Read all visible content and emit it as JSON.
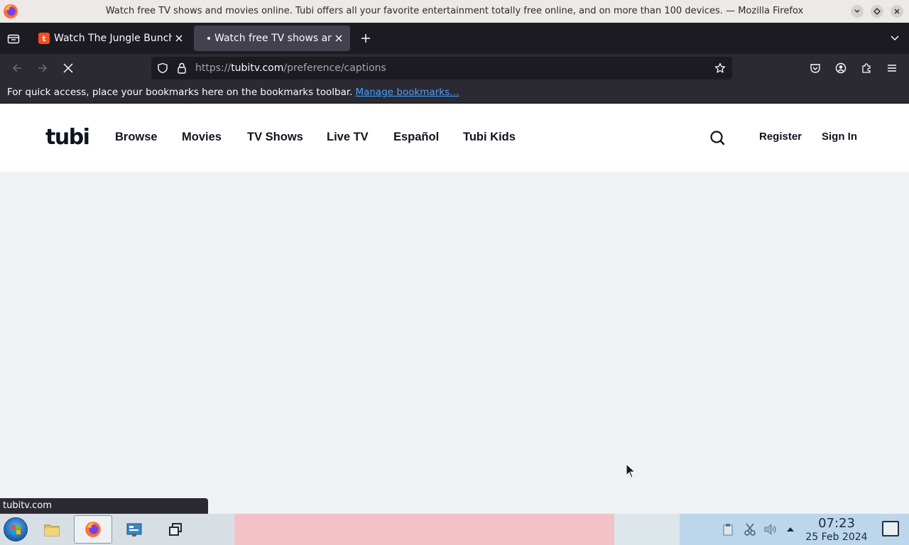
{
  "window": {
    "title": "Watch free TV shows and movies online. Tubi offers all your favorite entertainment totally free online, and on more than 100 devices. — Mozilla Firefox"
  },
  "tabs": [
    {
      "title": "Watch The Jungle Bunch",
      "active": false
    },
    {
      "title": "Watch free TV shows and",
      "active": true
    }
  ],
  "urlbar": {
    "scheme": "https://",
    "host": "tubitv.com",
    "path": "/preference/captions"
  },
  "bookmarks_bar": {
    "message": "For quick access, place your bookmarks here on the bookmarks toolbar.",
    "link": "Manage bookmarks…"
  },
  "site": {
    "logo": "tubi",
    "nav": [
      "Browse",
      "Movies",
      "TV Shows",
      "Live TV",
      "Español",
      "Tubi Kids"
    ],
    "register": "Register",
    "sign_in": "Sign In"
  },
  "status_text": "tubitv.com",
  "taskbar": {
    "time": "07:23",
    "date": "25 Feb 2024"
  },
  "colors": {
    "tubi_logo": "#10141f",
    "link_blue": "#45a1ff",
    "page_bg": "#eef2f5",
    "tab_active": "#42414d"
  }
}
